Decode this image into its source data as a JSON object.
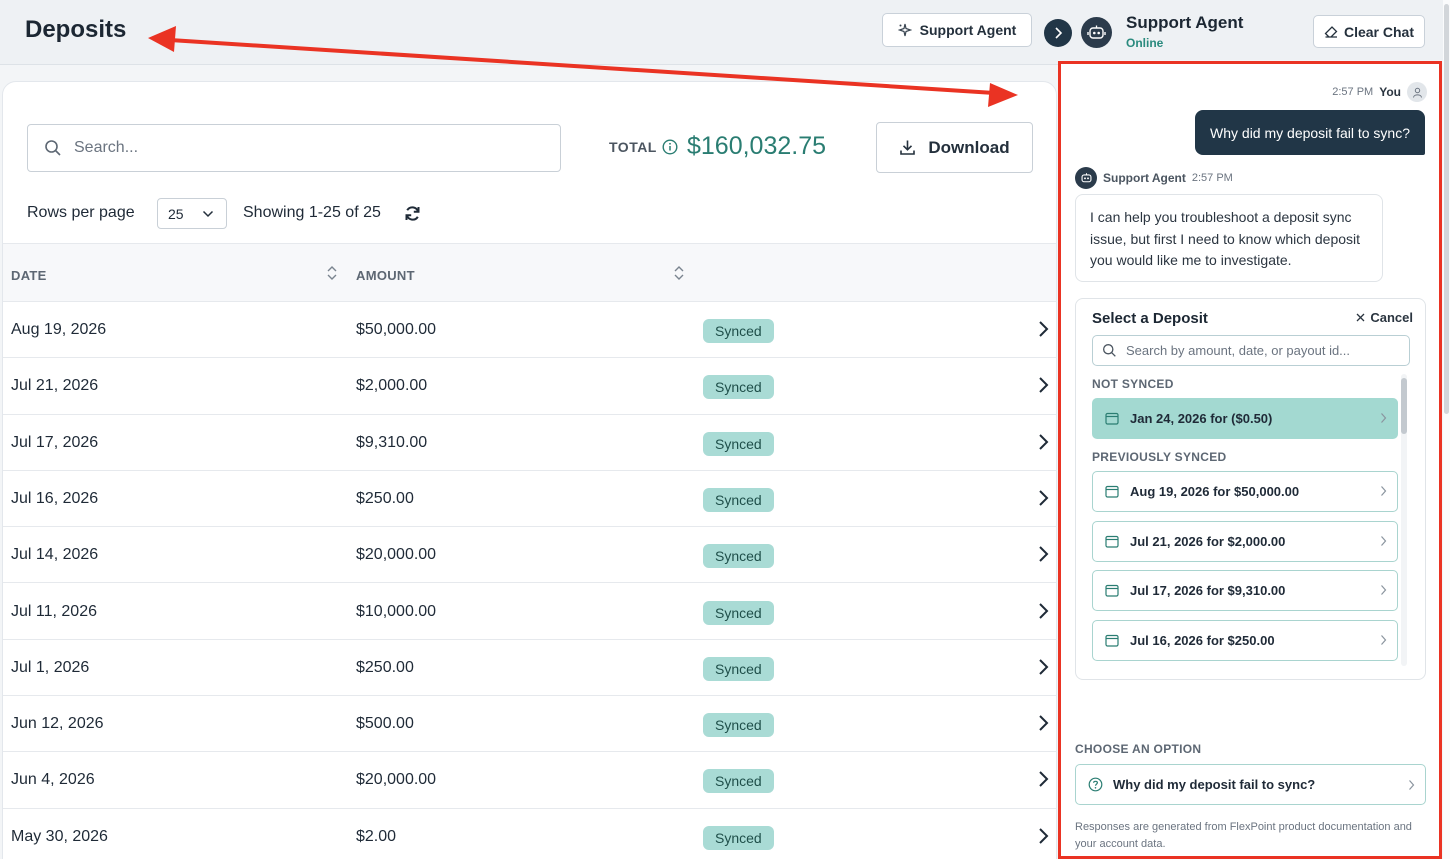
{
  "page": {
    "title": "Deposits"
  },
  "header": {
    "support_button": "Support Agent"
  },
  "toolbar": {
    "search_placeholder": "Search...",
    "total_label": "TOTAL",
    "total_value": "$160,032.75",
    "download_label": "Download",
    "rows_per_page_label": "Rows per page",
    "rows_per_page_value": "25",
    "showing_text": "Showing 1-25 of 25"
  },
  "table": {
    "columns": [
      "DATE",
      "AMOUNT"
    ],
    "rows": [
      {
        "date": "Aug 19, 2026",
        "amount": "$50,000.00",
        "status": "Synced"
      },
      {
        "date": "Jul 21, 2026",
        "amount": "$2,000.00",
        "status": "Synced"
      },
      {
        "date": "Jul 17, 2026",
        "amount": "$9,310.00",
        "status": "Synced"
      },
      {
        "date": "Jul 16, 2026",
        "amount": "$250.00",
        "status": "Synced"
      },
      {
        "date": "Jul 14, 2026",
        "amount": "$20,000.00",
        "status": "Synced"
      },
      {
        "date": "Jul 11, 2026",
        "amount": "$10,000.00",
        "status": "Synced"
      },
      {
        "date": "Jul 1, 2026",
        "amount": "$250.00",
        "status": "Synced"
      },
      {
        "date": "Jun 12, 2026",
        "amount": "$500.00",
        "status": "Synced"
      },
      {
        "date": "Jun 4, 2026",
        "amount": "$20,000.00",
        "status": "Synced"
      },
      {
        "date": "May 30, 2026",
        "amount": "$2.00",
        "status": "Synced"
      }
    ]
  },
  "chat": {
    "agent_name": "Support Agent",
    "agent_status": "Online",
    "clear_label": "Clear Chat",
    "user_time": "2:57 PM",
    "user_name": "You",
    "user_message": "Why did my deposit fail to sync?",
    "agent_label": "Support Agent",
    "agent_time": "2:57 PM",
    "agent_message": "I can help you troubleshoot a deposit sync issue, but first I need to know which deposit you would like me to investigate.",
    "select": {
      "title": "Select a Deposit",
      "cancel_label": "Cancel",
      "search_placeholder": "Search by amount, date, or payout id...",
      "not_synced_label": "NOT SYNCED",
      "not_synced_items": [
        "Jan 24, 2026 for ($0.50)"
      ],
      "previously_synced_label": "PREVIOUSLY SYNCED",
      "previously_synced_items": [
        "Aug 19, 2026 for $50,000.00",
        "Jul 21, 2026 for $2,000.00",
        "Jul 17, 2026 for $9,310.00",
        "Jul 16, 2026 for $250.00"
      ]
    },
    "choose_label": "CHOOSE AN OPTION",
    "option_label": "Why did my deposit fail to sync?",
    "footnote": "Responses are generated from FlexPoint product documentation and your account data."
  },
  "colors": {
    "accent_teal": "#2a7d72",
    "badge_bg": "#a9dbd5",
    "navy": "#213647",
    "annotation_red": "#ea3323"
  }
}
